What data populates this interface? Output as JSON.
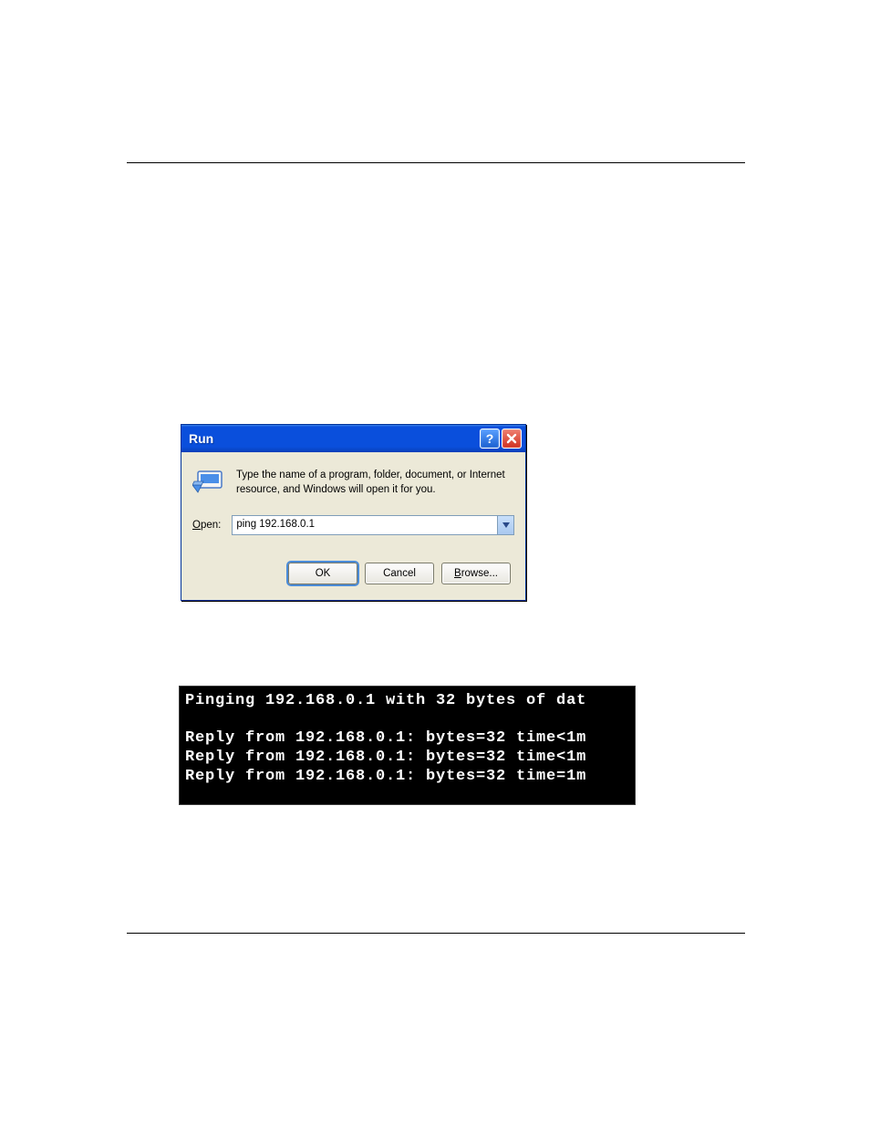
{
  "run_dialog": {
    "title": "Run",
    "help_label": "?",
    "intro": "Type the name of a program, folder, document, or Internet resource, and Windows will open it for you.",
    "open_label_pre": "O",
    "open_label_rest": "pen:",
    "open_value": "ping 192.168.0.1",
    "buttons": {
      "ok": "OK",
      "cancel": "Cancel",
      "browse_pre": "B",
      "browse_rest": "rowse..."
    }
  },
  "console": {
    "line1": "Pinging 192.168.0.1 with 32 bytes of dat",
    "blank": "",
    "line2": "Reply from 192.168.0.1: bytes=32 time<1m",
    "line3": "Reply from 192.168.0.1: bytes=32 time<1m",
    "line4": "Reply from 192.168.0.1: bytes=32 time=1m"
  }
}
